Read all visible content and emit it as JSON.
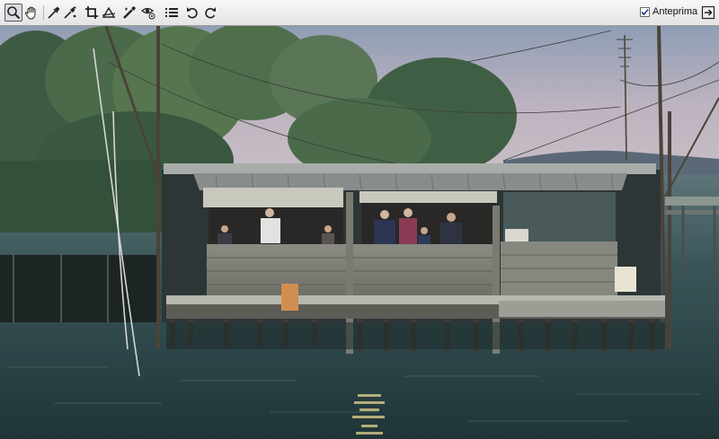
{
  "toolbar": {
    "tools": [
      {
        "name": "zoom-icon",
        "active": true
      },
      {
        "name": "hand-icon",
        "active": false
      },
      {
        "name": "eyedropper-icon",
        "active": false
      },
      {
        "name": "color-sampler-icon",
        "active": false
      },
      {
        "name": "crop-icon",
        "active": false
      },
      {
        "name": "straighten-icon",
        "active": false
      },
      {
        "name": "retouch-icon",
        "active": false
      },
      {
        "name": "red-eye-icon",
        "active": false
      },
      {
        "name": "preferences-list-icon",
        "active": false
      },
      {
        "name": "rotate-left-icon",
        "active": false
      },
      {
        "name": "rotate-right-icon",
        "active": false
      }
    ],
    "preview": {
      "label": "Anteprima",
      "checked": true
    },
    "fullscreen": {
      "name": "fullscreen-icon"
    }
  },
  "photo": {
    "subject": "stilt-fishing-hut-on-lagoon",
    "colors": {
      "sky": "#b9b7c6",
      "water": "#2e4a4e",
      "roof": "#8a9090",
      "wood": "#7d7f76"
    }
  }
}
